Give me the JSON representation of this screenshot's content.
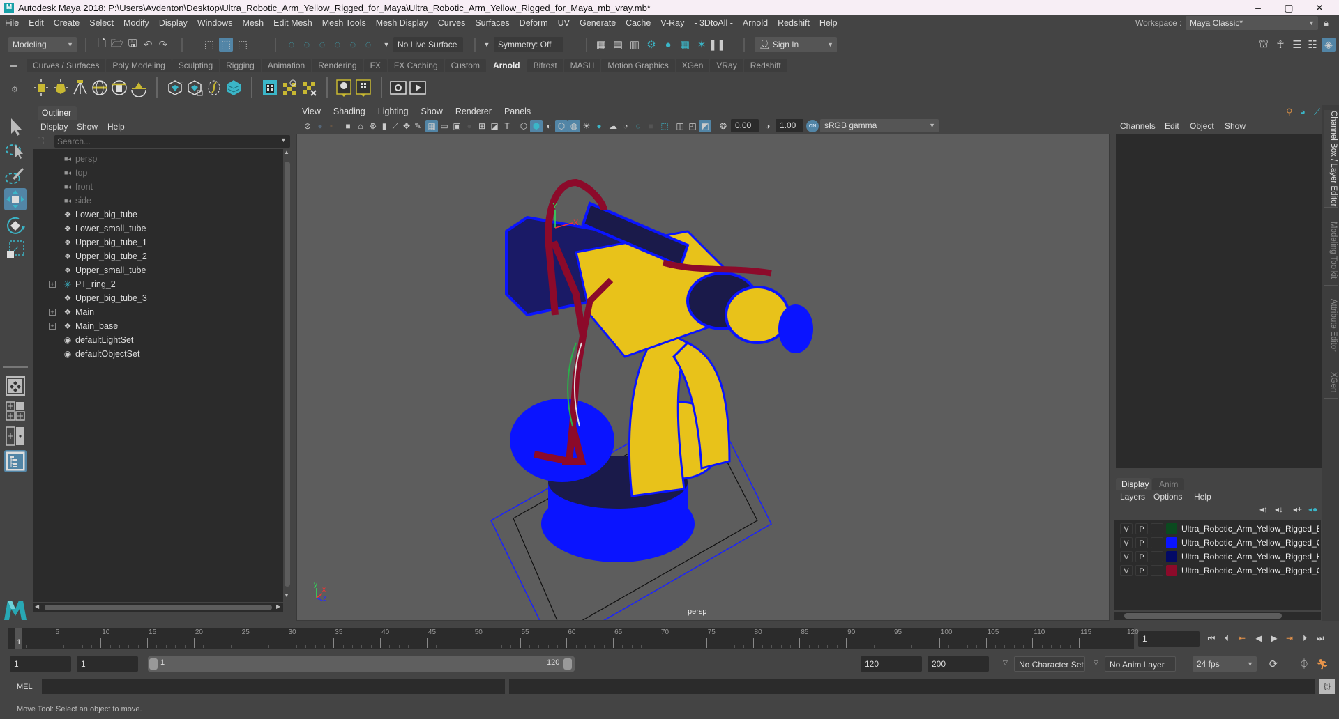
{
  "window": {
    "title": "Autodesk Maya 2018: P:\\Users\\Avdenton\\Desktop\\Ultra_Robotic_Arm_Yellow_Rigged_for_Maya\\Ultra_Robotic_Arm_Yellow_Rigged_for_Maya_mb_vray.mb*",
    "app_icon": "M",
    "minimize": "–",
    "maximize": "▢",
    "close": "✕"
  },
  "menubar": {
    "items": [
      "File",
      "Edit",
      "Create",
      "Select",
      "Modify",
      "Display",
      "Windows",
      "Mesh",
      "Edit Mesh",
      "Mesh Tools",
      "Mesh Display",
      "Curves",
      "Surfaces",
      "Deform",
      "UV",
      "Generate",
      "Cache",
      "V-Ray",
      "- 3DtoAll -",
      "Arnold",
      "Redshift",
      "Help"
    ],
    "workspace_label": "Workspace :",
    "workspace_value": "Maya Classic*"
  },
  "statusline": {
    "menuset": "Modeling",
    "live_surface": "No Live Surface",
    "symmetry": "Symmetry: Off",
    "sign_in": "Sign In"
  },
  "shelf": {
    "tabs": [
      "Curves / Surfaces",
      "Poly Modeling",
      "Sculpting",
      "Rigging",
      "Animation",
      "Rendering",
      "FX",
      "FX Caching",
      "Custom",
      "Arnold",
      "Bifrost",
      "MASH",
      "Motion Graphics",
      "XGen",
      "VRay",
      "Redshift"
    ],
    "active_tab": "Arnold"
  },
  "outliner": {
    "tab": "Outliner",
    "menu": [
      "Display",
      "Show",
      "Help"
    ],
    "search_placeholder": "Search...",
    "items": [
      {
        "label": "persp",
        "icon": "camera-icon",
        "dim": true,
        "expandable": false
      },
      {
        "label": "top",
        "icon": "camera-icon",
        "dim": true,
        "expandable": false
      },
      {
        "label": "front",
        "icon": "camera-icon",
        "dim": true,
        "expandable": false
      },
      {
        "label": "side",
        "icon": "camera-icon",
        "dim": true,
        "expandable": false
      },
      {
        "label": "Lower_big_tube",
        "icon": "transform-icon",
        "dim": false,
        "expandable": false
      },
      {
        "label": "Lower_small_tube",
        "icon": "transform-icon",
        "dim": false,
        "expandable": false
      },
      {
        "label": "Upper_big_tube_1",
        "icon": "transform-icon",
        "dim": false,
        "expandable": false
      },
      {
        "label": "Upper_big_tube_2",
        "icon": "transform-icon",
        "dim": false,
        "expandable": false
      },
      {
        "label": "Upper_small_tube",
        "icon": "transform-icon",
        "dim": false,
        "expandable": false
      },
      {
        "label": "PT_ring_2",
        "icon": "joint-icon",
        "dim": false,
        "expandable": true
      },
      {
        "label": "Upper_big_tube_3",
        "icon": "transform-icon",
        "dim": false,
        "expandable": false
      },
      {
        "label": "Main",
        "icon": "transform-icon",
        "dim": false,
        "expandable": true
      },
      {
        "label": "Main_base",
        "icon": "transform-icon",
        "dim": false,
        "expandable": true
      },
      {
        "label": "defaultLightSet",
        "icon": "set-icon",
        "dim": false,
        "expandable": false
      },
      {
        "label": "defaultObjectSet",
        "icon": "set-icon",
        "dim": false,
        "expandable": false
      }
    ]
  },
  "viewport": {
    "menu": [
      "View",
      "Shading",
      "Lighting",
      "Show",
      "Renderer",
      "Panels"
    ],
    "exposure": "0.00",
    "gamma": "1.00",
    "color_space": "sRGB gamma",
    "color_mgmt_toggle": "ON",
    "camera_label": "persp",
    "axis": {
      "x": "x",
      "y": "y",
      "z": "z"
    },
    "manip_x": "X",
    "manip_y": "Y"
  },
  "channelbox": {
    "menu": [
      "Channels",
      "Edit",
      "Object",
      "Show"
    ]
  },
  "layereditor": {
    "tabs": [
      "Display",
      "Anim"
    ],
    "active_tab": "Display",
    "menu": [
      "Layers",
      "Options",
      "Help"
    ],
    "layers": [
      {
        "v": "V",
        "p": "P",
        "color": "#0b4a1f",
        "name": "Ultra_Robotic_Arm_Yellow_Rigged_Bones"
      },
      {
        "v": "V",
        "p": "P",
        "color": "#0a14ff",
        "name": "Ultra_Robotic_Arm_Yellow_Rigged_Controllers"
      },
      {
        "v": "V",
        "p": "P",
        "color": "#030a66",
        "name": "Ultra_Robotic_Arm_Yellow_Rigged_Helpers"
      },
      {
        "v": "V",
        "p": "P",
        "color": "#8c0a2a",
        "name": "Ultra_Robotic_Arm_Yellow_Rigged_Geometry"
      }
    ]
  },
  "side_tabs": [
    "Channel Box / Layer Editor",
    "Modeling Toolkit",
    "Attribute Editor",
    "XGen"
  ],
  "timeslider": {
    "ticks": [
      "5",
      "10",
      "15",
      "20",
      "25",
      "30",
      "35",
      "40",
      "45",
      "50",
      "55",
      "60",
      "65",
      "70",
      "75",
      "80",
      "85",
      "90",
      "95",
      "100",
      "105",
      "110",
      "115",
      "120"
    ],
    "current_frame_marker": "1",
    "current_frame": "1"
  },
  "rangeslider": {
    "start_time": "1",
    "playback_start": "1",
    "range_start_label": "1",
    "range_end_label": "120",
    "playback_end": "120",
    "end_time": "200",
    "character_set": "No Character Set",
    "anim_layer": "No Anim Layer",
    "fps": "24 fps"
  },
  "cmdline": {
    "label": "MEL"
  },
  "helpline": {
    "text": "Move Tool: Select an object to move."
  },
  "colors": {
    "accent": "#5285a6",
    "viewport_bg": "#5d5d5d",
    "panel_bg": "#444444",
    "field_bg": "#2b2b2b",
    "wire_blue": "#0a14ff",
    "mesh_yellow": "#e8c21a",
    "rig_red": "#8c0a2a"
  }
}
